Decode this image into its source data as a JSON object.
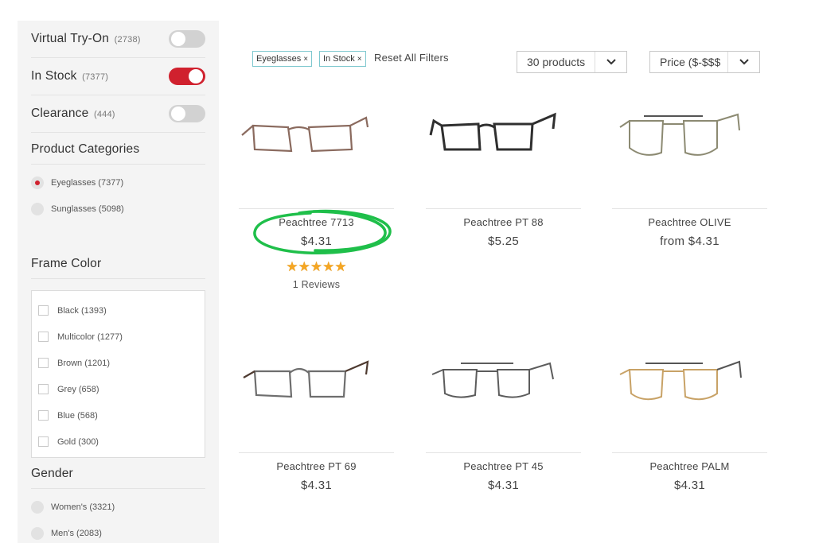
{
  "filters": {
    "toggles": [
      {
        "label": "Virtual Try-On",
        "count": "(2738)",
        "on": false
      },
      {
        "label": "In Stock",
        "count": "(7377)",
        "on": true
      },
      {
        "label": "Clearance",
        "count": "(444)",
        "on": false
      }
    ],
    "categories": {
      "title": "Product Categories",
      "items": [
        {
          "label": "Eyeglasses (7377)",
          "selected": true
        },
        {
          "label": "Sunglasses (5098)",
          "selected": false
        }
      ]
    },
    "frame_color": {
      "title": "Frame Color",
      "items": [
        "Black (1393)",
        "Multicolor (1277)",
        "Brown (1201)",
        "Grey (658)",
        "Blue (568)",
        "Gold (300)"
      ]
    },
    "gender": {
      "title": "Gender",
      "items": [
        "Women's (3321)",
        "Men's (2083)"
      ]
    }
  },
  "active_chips": [
    {
      "label": "Eyeglasses",
      "remove": "×"
    },
    {
      "label": "In Stock",
      "remove": "×"
    }
  ],
  "reset_label": "Reset All Filters",
  "product_count_select": "30 products",
  "sort_select": "Price ($-$$$",
  "products": [
    {
      "name": "Peachtree 7713",
      "price": "$4.31",
      "stars": "★★★★★",
      "reviews": "1 Reviews",
      "frame_color": "#8a6a5e"
    },
    {
      "name": "Peachtree PT 88",
      "price": "$5.25",
      "frame_color": "#2f2f2f"
    },
    {
      "name": "Peachtree OLIVE",
      "price": "from $4.31",
      "frame_color": "#8c8a72"
    },
    {
      "name": "Peachtree PT 69",
      "price": "$4.31",
      "frame_color": "#6e6e6e"
    },
    {
      "name": "Peachtree PT 45",
      "price": "$4.31",
      "frame_color": "#5c5c5c"
    },
    {
      "name": "Peachtree PALM",
      "price": "$4.31",
      "frame_color": "#c8a266"
    }
  ],
  "colors": {
    "accent_red": "#d0212e",
    "chip_border": "#7fc8cf",
    "star": "#f5a623",
    "highlight_circle": "#1fbf4a"
  }
}
